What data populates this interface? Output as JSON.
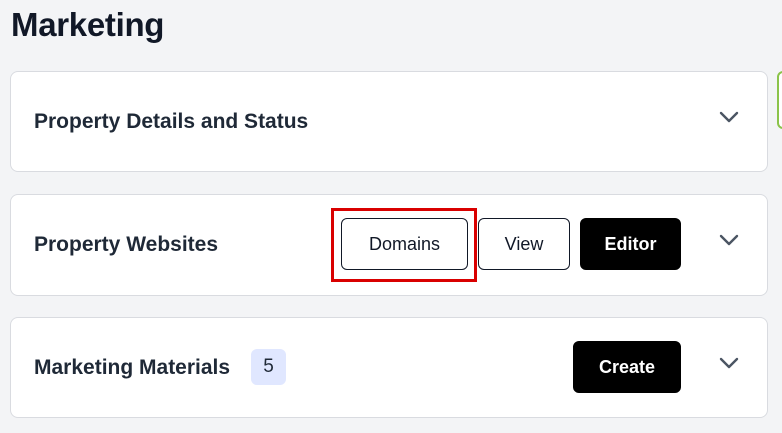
{
  "page": {
    "title": "Marketing"
  },
  "sections": [
    {
      "title": "Property Details and Status"
    },
    {
      "title": "Property Websites",
      "buttons": {
        "domains": "Domains",
        "view": "View",
        "editor": "Editor"
      }
    },
    {
      "title": "Marketing Materials",
      "count": "5",
      "buttons": {
        "create": "Create"
      }
    }
  ],
  "icons": {
    "expand": "chevron-down-icon"
  },
  "colors": {
    "primary_button": "#000000",
    "highlight": "#d90000",
    "badge_bg": "#e0e7ff",
    "edge_accent": "#8bc34a"
  }
}
